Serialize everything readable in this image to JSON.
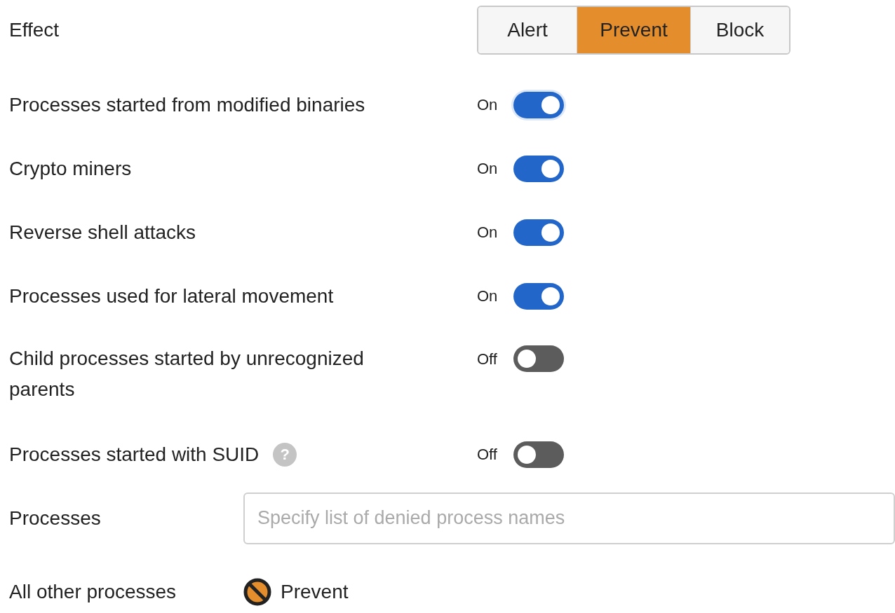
{
  "effect": {
    "label": "Effect",
    "options": [
      {
        "label": "Alert",
        "selected": false
      },
      {
        "label": "Prevent",
        "selected": true
      },
      {
        "label": "Block",
        "selected": false
      }
    ]
  },
  "toggles": [
    {
      "label": "Processes started from modified binaries",
      "state_text": "On",
      "on": true,
      "focused": true
    },
    {
      "label": "Crypto miners",
      "state_text": "On",
      "on": true,
      "focused": false
    },
    {
      "label": "Reverse shell attacks",
      "state_text": "On",
      "on": true,
      "focused": false
    },
    {
      "label": "Processes used for lateral movement",
      "state_text": "On",
      "on": true,
      "focused": false
    },
    {
      "label": "Child processes started by unrecognized parents",
      "state_text": "Off",
      "on": false,
      "focused": false
    },
    {
      "label": "Processes started with SUID",
      "state_text": "Off",
      "on": false,
      "focused": false,
      "help": "?"
    }
  ],
  "processes": {
    "label": "Processes",
    "placeholder": "Specify list of denied process names"
  },
  "other": {
    "label": "All other processes",
    "value": "Prevent"
  }
}
